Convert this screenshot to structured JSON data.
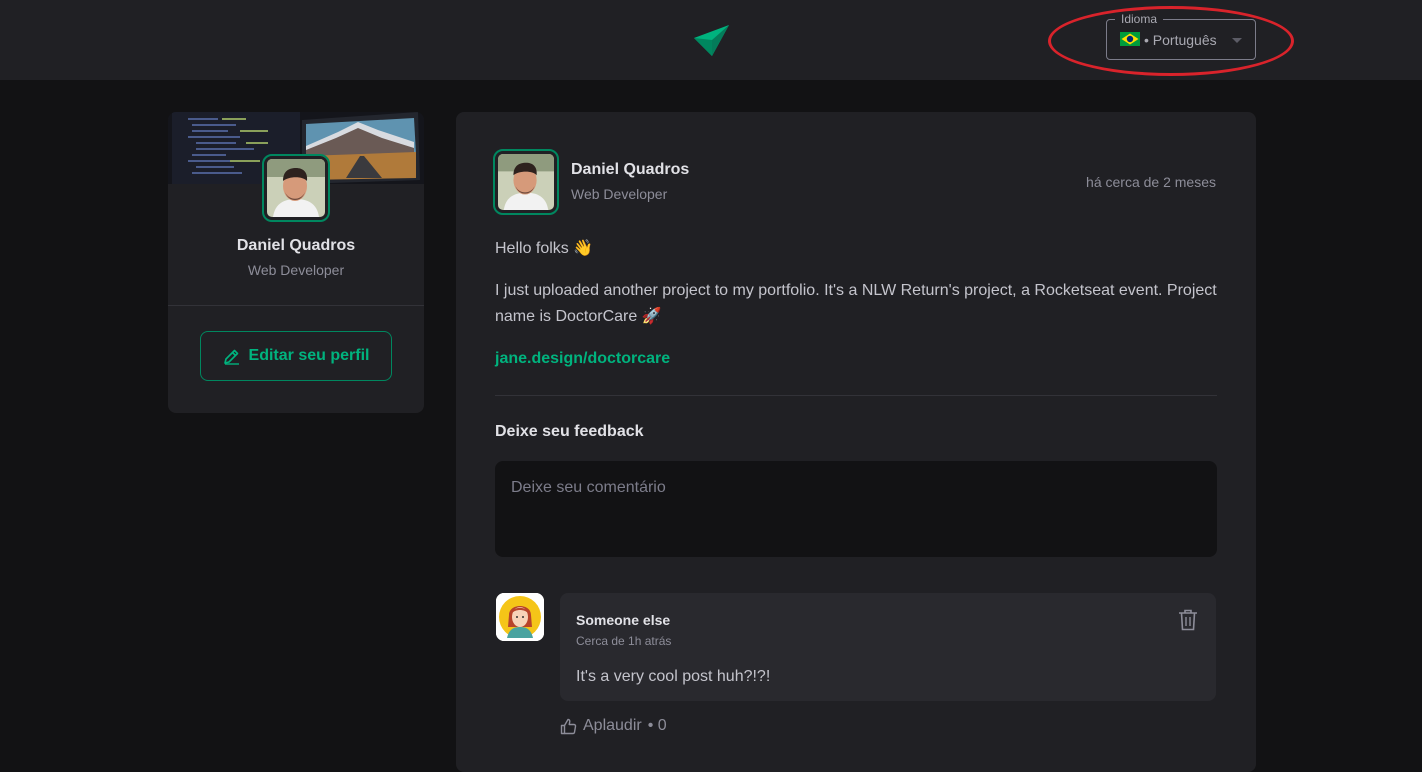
{
  "header": {
    "language": {
      "legend": "Idioma",
      "flag_icon": "brazil-flag-icon",
      "value": "• Português"
    }
  },
  "sidebar": {
    "name": "Daniel Quadros",
    "role": "Web Developer",
    "edit_button": "Editar seu perfil"
  },
  "post": {
    "author": "Daniel Quadros",
    "role": "Web Developer",
    "time": "há cerca de 2 meses",
    "paragraphs": [
      "Hello folks 👋",
      "I just uploaded another project to my portfolio. It's a NLW Return's project, a Rocketseat event. Project name is DoctorCare 🚀"
    ],
    "link": "jane.design/doctorcare",
    "feedback_title": "Deixe seu feedback",
    "comment_placeholder": "Deixe seu comentário"
  },
  "comment": {
    "author": "Someone else",
    "time": "Cerca de 1h atrás",
    "text": "It's a very cool post huh?!?!",
    "applaud_label": "Aplaudir",
    "applaud_count": "• 0"
  },
  "colors": {
    "brand": "#00875f",
    "brand_light": "#00b37e",
    "annotation": "#d9232b"
  }
}
